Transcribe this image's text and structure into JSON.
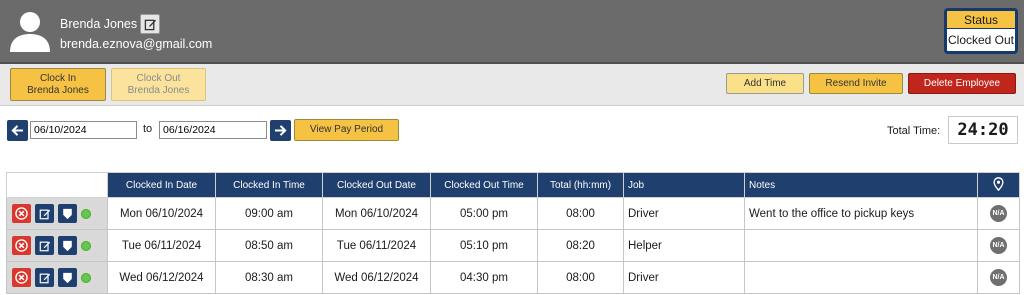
{
  "header": {
    "user_name": "Brenda Jones",
    "email": "brenda.eznova@gmail.com",
    "status_title": "Status",
    "status_value": "Clocked Out"
  },
  "toolbar": {
    "clock_in_line1": "Clock In",
    "clock_in_line2": "Brenda Jones",
    "clock_out_line1": "Clock Out",
    "clock_out_line2": "Brenda Jones",
    "add_time": "Add Time",
    "resend_invite": "Resend Invite",
    "delete_employee": "Delete Employee"
  },
  "filter": {
    "start_date": "06/10/2024",
    "to_label": "to",
    "end_date": "06/16/2024",
    "view_pay_period": "View Pay Period",
    "total_time_label": "Total Time:",
    "total_time_value": "24:20"
  },
  "table": {
    "headers": {
      "clocked_in_date": "Clocked In Date",
      "clocked_in_time": "Clocked In Time",
      "clocked_out_date": "Clocked Out Date",
      "clocked_out_time": "Clocked Out Time",
      "total": "Total (hh:mm)",
      "job": "Job",
      "notes": "Notes"
    },
    "rows": [
      {
        "in_date": "Mon 06/10/2024",
        "in_time": "09:00 am",
        "out_date": "Mon 06/10/2024",
        "out_time": "05:00 pm",
        "total": "08:00",
        "job": "Driver",
        "notes": "Went to the office to pickup keys",
        "location": "N/A"
      },
      {
        "in_date": "Tue 06/11/2024",
        "in_time": "08:50 am",
        "out_date": "Tue 06/11/2024",
        "out_time": "05:10 pm",
        "total": "08:20",
        "job": "Helper",
        "notes": "",
        "location": "N/A"
      },
      {
        "in_date": "Wed 06/12/2024",
        "in_time": "08:30 am",
        "out_date": "Wed 06/12/2024",
        "out_time": "04:30 pm",
        "total": "08:00",
        "job": "Driver",
        "notes": "",
        "location": "N/A"
      }
    ]
  },
  "colors": {
    "navy": "#1f3f6e",
    "gold": "#f6c244",
    "danger": "#c0261c",
    "online": "#63c94a"
  },
  "icons": {
    "avatar": "user-silhouette-icon",
    "edit": "edit-icon",
    "delete": "x-circle-icon",
    "badge": "shield-icon",
    "location": "map-pin-icon",
    "prev": "arrow-left-icon",
    "next": "arrow-right-icon"
  }
}
